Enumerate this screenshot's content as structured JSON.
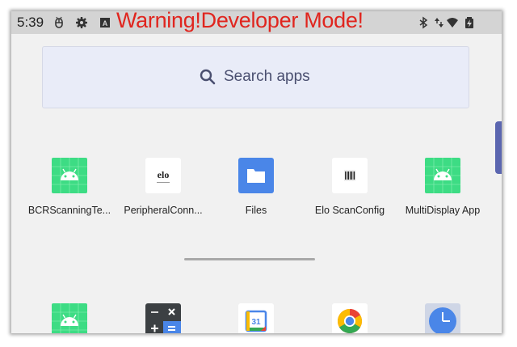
{
  "statusbar": {
    "time": "5:39",
    "warning": "Warning!Developer Mode!",
    "left_icons": [
      "usb-debug-icon",
      "gear-icon",
      "a-box-icon"
    ],
    "right_icons": [
      "bluetooth-icon",
      "data-arrows-icon",
      "wifi-icon",
      "battery-charging-icon"
    ],
    "warning_color": "#e0251e"
  },
  "search": {
    "placeholder": "Search apps",
    "icon": "search-icon"
  },
  "apps_row1": [
    {
      "label": "BCRScanningTe...",
      "icon": "android-icon"
    },
    {
      "label": "PeripheralConn...",
      "icon": "elo-logo-icon"
    },
    {
      "label": "Files",
      "icon": "folder-icon"
    },
    {
      "label": "Elo ScanConfig",
      "icon": "barcode-icon"
    },
    {
      "label": "MultiDisplay App",
      "icon": "android-icon"
    }
  ],
  "apps_row2": [
    {
      "icon": "android-icon"
    },
    {
      "icon": "calculator-icon"
    },
    {
      "icon": "calendar-icon",
      "badge": "31"
    },
    {
      "icon": "chrome-icon"
    },
    {
      "icon": "clock-icon"
    }
  ],
  "elo_text": "elo",
  "colors": {
    "accent": "#5b66b0",
    "android_green": "#3ddc84",
    "files_blue": "#4a86e8"
  }
}
